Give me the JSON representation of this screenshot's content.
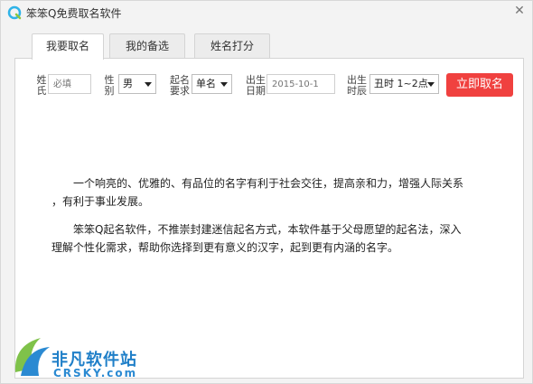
{
  "window": {
    "title": "笨笨Q免费取名软件",
    "close_icon": "close-icon"
  },
  "tabs": [
    {
      "label": "我要取名",
      "active": true
    },
    {
      "label": "我的备选",
      "active": false
    },
    {
      "label": "姓名打分",
      "active": false
    }
  ],
  "form": {
    "surname": {
      "label_line1": "姓",
      "label_line2": "氏",
      "placeholder": "必填",
      "value": ""
    },
    "gender": {
      "label_line1": "性",
      "label_line2": "别",
      "value": "男"
    },
    "naming": {
      "label_line1": "起名",
      "label_line2": "要求",
      "value": "单名"
    },
    "birth_date": {
      "label_line1": "出生",
      "label_line2": "日期",
      "placeholder": "2015-10-1",
      "value": ""
    },
    "birth_time": {
      "label_line1": "出生",
      "label_line2": "时辰",
      "value": "丑时 1~2点"
    },
    "submit_label": "立即取名"
  },
  "intro": {
    "p1_line1": "一个响亮的、优雅的、有品位的名字有利于社会交往，提高亲和力，增强人际关系",
    "p1_line2": "，有利于事业发展。",
    "p2_line1": "笨笨Q起名软件，不推崇封建迷信起名方式，本软件基于父母愿望的起名法，深入",
    "p2_line2": "理解个性化需求，帮助你选择到更有意义的汉字，起到更有内涵的名字。"
  },
  "watermark": {
    "cn": "非凡软件站",
    "en": "CRSKY.com"
  },
  "colors": {
    "accent": "#f0413f",
    "logo": "#2fb3e8",
    "watermark": "#1f7fc8"
  }
}
